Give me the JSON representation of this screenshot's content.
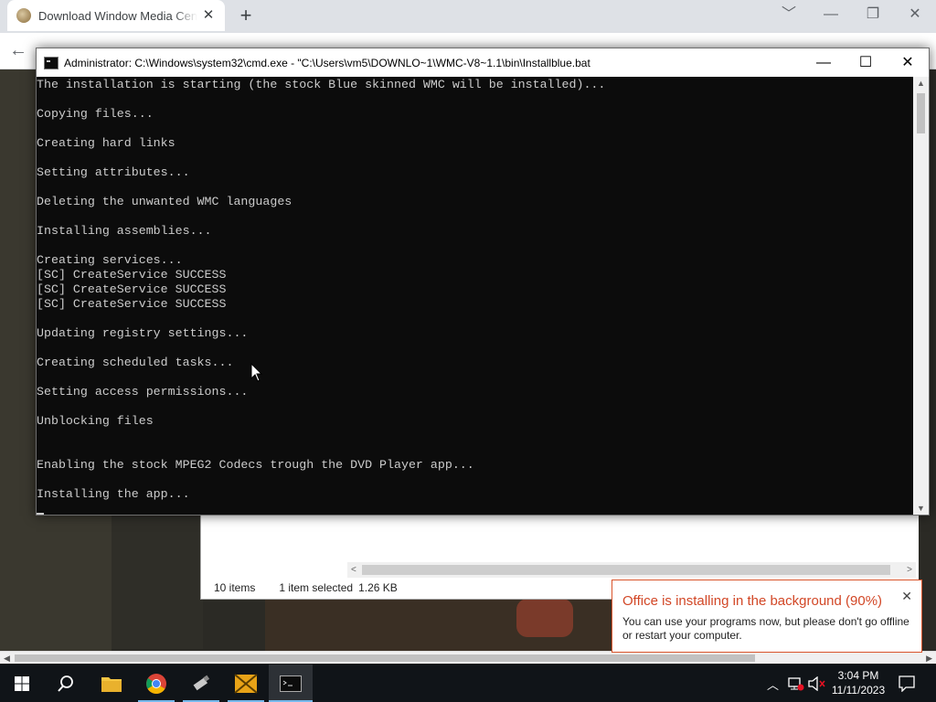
{
  "browser": {
    "tab_title": "Download Window Media Center",
    "tab_close": "✕",
    "new_tab": "+",
    "min": "﹀",
    "minimize": "—",
    "restore": "❐",
    "close": "✕",
    "back": "←"
  },
  "explorer": {
    "items_count": "10 items",
    "selection": "1 item selected",
    "size": "1.26 KB"
  },
  "cmd": {
    "title": "Administrator: C:\\Windows\\system32\\cmd.exe - \"C:\\Users\\vm5\\DOWNLO~1\\WMC-V8~1.1\\bin\\Installblue.bat",
    "minimize": "—",
    "maximize": "☐",
    "close": "✕",
    "lines": [
      "The installation is starting (the stock Blue skinned WMC will be installed)...",
      "",
      "Copying files...",
      "",
      "Creating hard links",
      "",
      "Setting attributes...",
      "",
      "Deleting the unwanted WMC languages",
      "",
      "Installing assemblies...",
      "",
      "Creating services...",
      "[SC] CreateService SUCCESS",
      "[SC] CreateService SUCCESS",
      "[SC] CreateService SUCCESS",
      "",
      "Updating registry settings...",
      "",
      "Creating scheduled tasks...",
      "",
      "Setting access permissions...",
      "",
      "Unblocking files",
      "",
      "",
      "Enabling the stock MPEG2 Codecs trough the DVD Player app...",
      "",
      "Installing the app..."
    ]
  },
  "notification": {
    "title": "Office is installing in the background (90%)",
    "body": "You can use your programs now, but please don't go offline or restart your computer.",
    "close": "✕"
  },
  "taskbar": {
    "time": "3:04 PM",
    "date": "11/11/2023"
  }
}
